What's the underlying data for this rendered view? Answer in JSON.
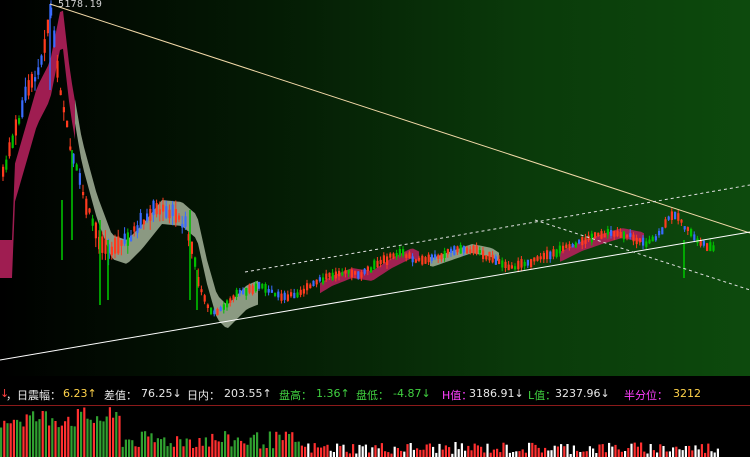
{
  "chart": {
    "peak_label": "5178.19",
    "colors": {
      "up": "#ff3b1f",
      "down": "#00c000",
      "blue": "#3a6cff",
      "ribbon_pink": "#b0205a",
      "ribbon_grey": "#9aa890",
      "trendline": "#f2d9a8",
      "support": "#ffffff",
      "dotted": "#e0e0e0"
    }
  },
  "stats": {
    "lead_arrow": "↓",
    "day_amplitude_label": "，日震幅：",
    "day_amplitude_value": "6.23↑",
    "diff_label": "差值：",
    "diff_value": "76.25↓",
    "intraday_label": "日内：",
    "intraday_value": "203.55↑",
    "high_label": "盘高：",
    "high_value": "1.36↑",
    "low_label": "盘低：",
    "low_value": "-4.87↓",
    "h_label": "H值：",
    "h_value": "3186.91↓",
    "l_label": "L值：",
    "l_value": "3237.96↓",
    "half_label": "半分位：",
    "half_value": "3212"
  }
}
